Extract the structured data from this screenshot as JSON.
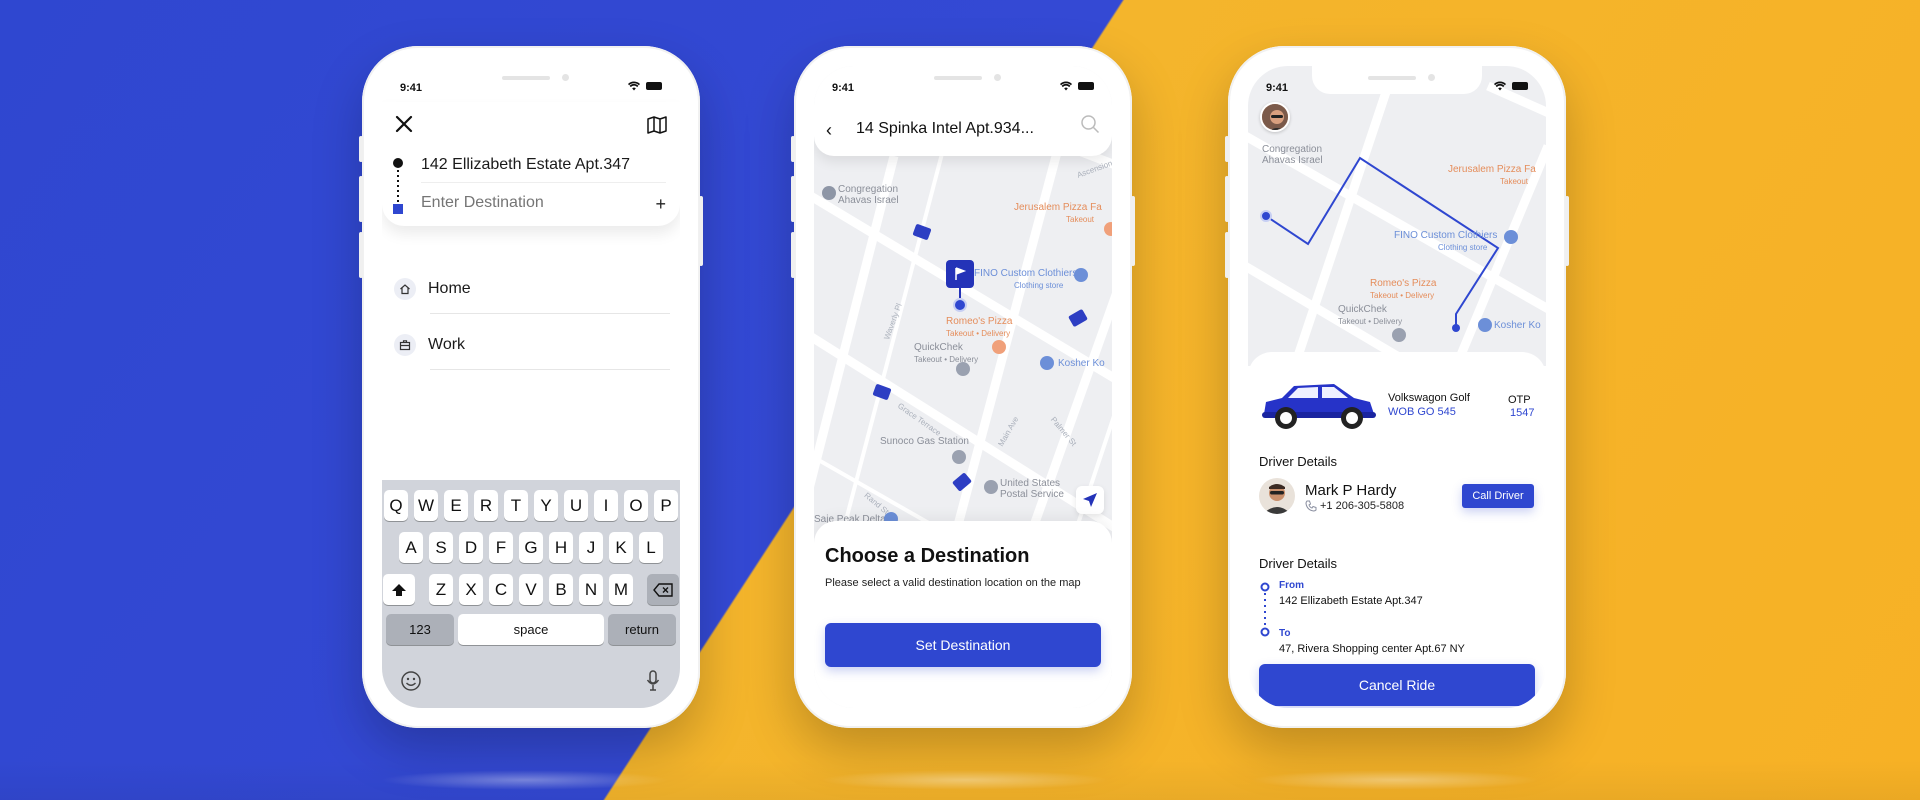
{
  "phone1": {
    "status_time": "9:41",
    "origin": "142 Ellizabeth Estate Apt.347",
    "destination_placeholder": "Enter Destination",
    "places": [
      {
        "icon": "home-icon",
        "label": "Home"
      },
      {
        "icon": "briefcase-icon",
        "label": "Work"
      }
    ],
    "keyboard": {
      "row1": [
        "Q",
        "W",
        "E",
        "R",
        "T",
        "Y",
        "U",
        "I",
        "O",
        "P"
      ],
      "row2": [
        "A",
        "S",
        "D",
        "F",
        "G",
        "H",
        "J",
        "K",
        "L"
      ],
      "row3": [
        "Z",
        "X",
        "C",
        "V",
        "B",
        "N",
        "M"
      ],
      "numbers_key": "123",
      "space_key": "space",
      "return_key": "return"
    }
  },
  "phone2": {
    "status_time": "9:41",
    "search_address": "14 Spinka Intel Apt.934...",
    "map_labels": {
      "congregation": "Congregation\nAhavas Israel",
      "jerusalem": "Jerusalem Pizza Fa",
      "jerusalem_sub": "Takeout",
      "fino": "FINO Custom Clothiers",
      "fino_sub": "Clothing store",
      "romeos": "Romeo's Pizza",
      "romeos_sub": "Takeout • Delivery",
      "quickchek": "QuickChek",
      "quickchek_sub": "Takeout • Delivery",
      "kosher": "Kosher Ko",
      "sunoco": "Sunoco Gas Station",
      "usps": "United States\nPostal Service",
      "delta": "Saje Peak Delta",
      "road_wolfe": "Waverly Pl",
      "road_grace": "Grace Terrace",
      "road_main": "Main Ave",
      "road_palmer": "Palmer St",
      "road_rand": "Rand St",
      "road_ascension": "Ascension St"
    },
    "sheet_title": "Choose a Destination",
    "sheet_text": "Please select a valid destination location on the map",
    "button": "Set Destination"
  },
  "phone3": {
    "status_time": "9:41",
    "map_labels": {
      "congregation": "Congregation\nAhavas Israel",
      "jerusalem": "Jerusalem Pizza Fa",
      "jerusalem_sub": "Takeout",
      "fino": "FINO Custom Clothiers",
      "fino_sub": "Clothing store",
      "romeos": "Romeo's Pizza",
      "romeos_sub": "Takeout • Delivery",
      "quickchek": "QuickChek",
      "quickchek_sub": "Takeout • Delivery",
      "kosher": "Kosher Ko"
    },
    "car_name": "Volkswagon Golf",
    "car_plate": "WOB GO 545",
    "otp_label": "OTP",
    "otp_value": "1547",
    "driver_section": "Driver Details",
    "driver_name": "Mark P Hardy",
    "driver_phone": "+1 206-305-5808",
    "call_button": "Call Driver",
    "trip_section": "Driver Details",
    "from_label": "From",
    "from_value": "142 Ellizabeth Estate Apt.347",
    "to_label": "To",
    "to_value": "47, Rivera Shopping center Apt.67 NY",
    "cancel_button": "Cancel Ride"
  },
  "colors": {
    "blue": "#2f47d0",
    "yellow": "#f6b326"
  }
}
